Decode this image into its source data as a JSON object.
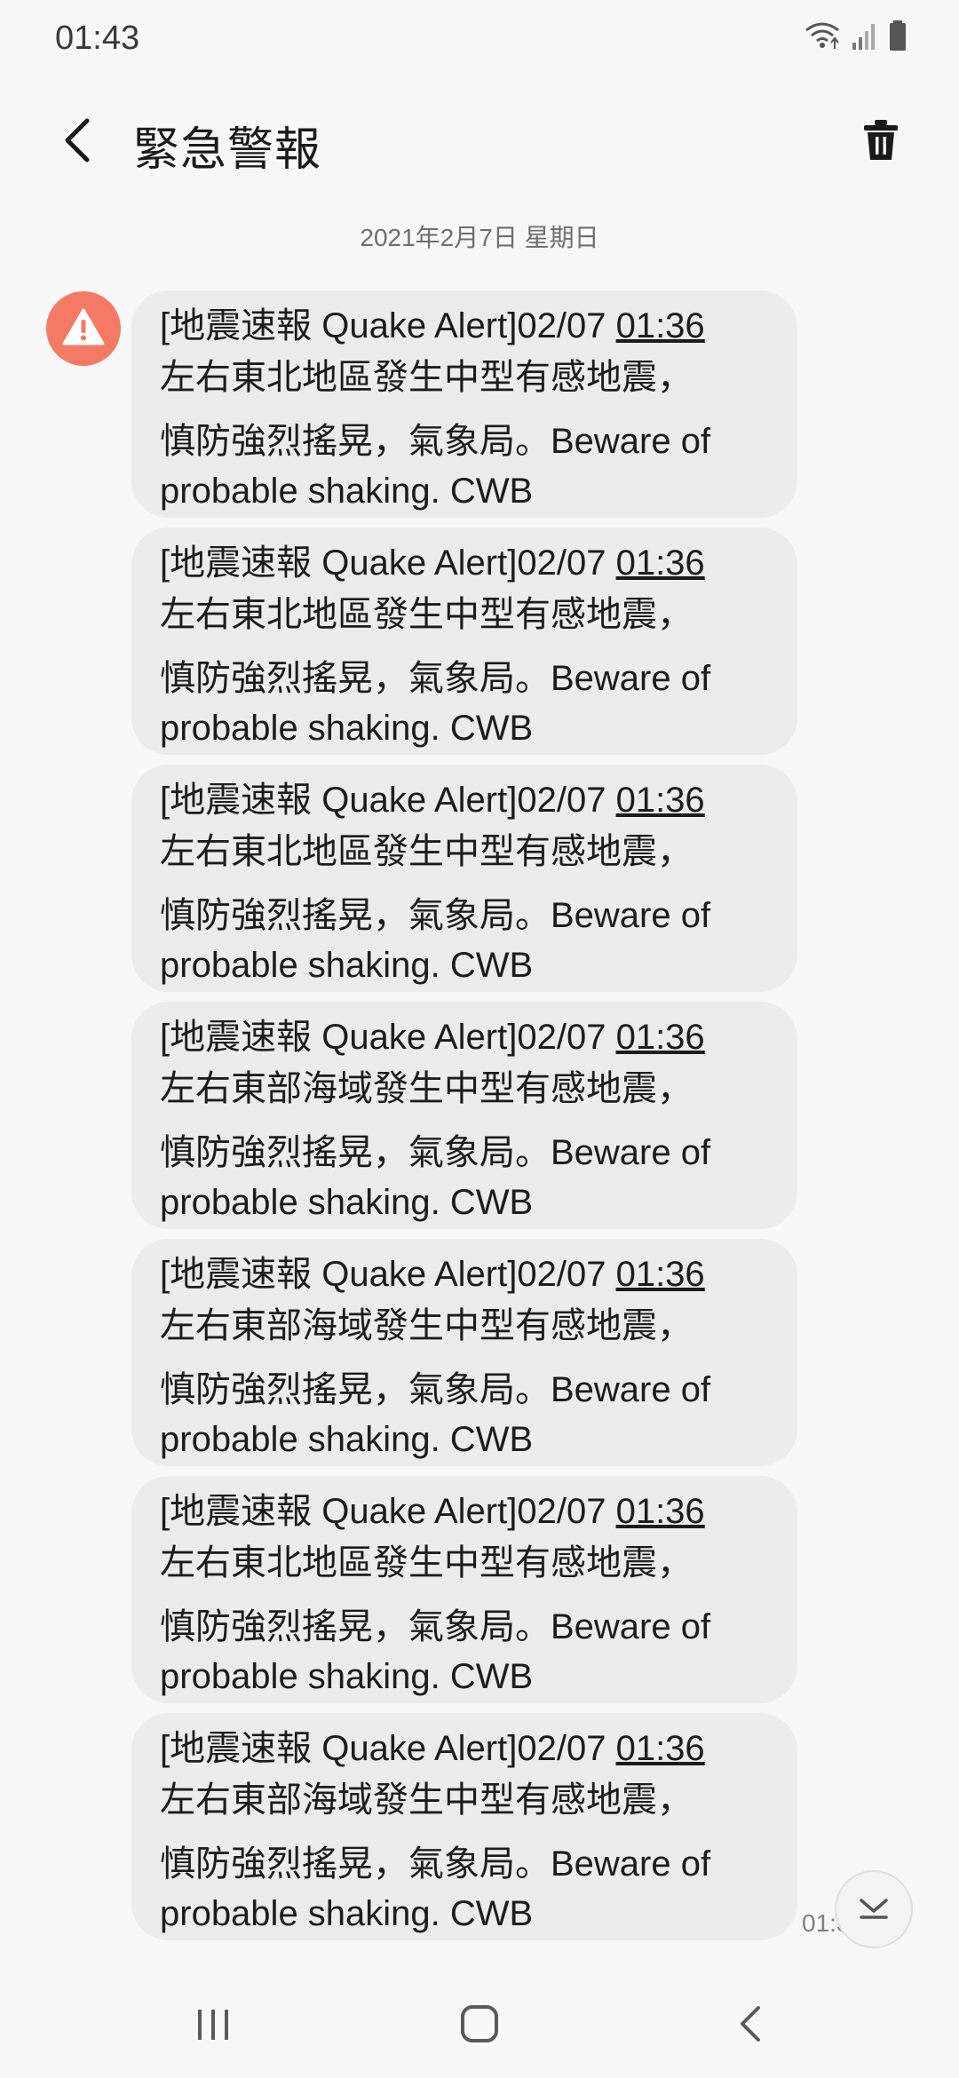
{
  "status_bar": {
    "time": "01:43"
  },
  "header": {
    "title": "緊急警報"
  },
  "date_separator": "2021年2月7日 星期日",
  "messages": [
    {
      "prefix": "[地震速報 Quake Alert]02/07 ",
      "time_link": "01:36",
      "line2": "左右東北地區發生中型有感地震，",
      "line3": "慎防強烈搖晃，氣象局。Beware of",
      "line4": "probable shaking. CWB"
    },
    {
      "prefix": "[地震速報 Quake Alert]02/07 ",
      "time_link": "01:36",
      "line2": "左右東北地區發生中型有感地震，",
      "line3": "慎防強烈搖晃，氣象局。Beware of",
      "line4": "probable shaking. CWB"
    },
    {
      "prefix": "[地震速報 Quake Alert]02/07 ",
      "time_link": "01:36",
      "line2": "左右東北地區發生中型有感地震，",
      "line3": "慎防強烈搖晃，氣象局。Beware of",
      "line4": "probable shaking. CWB"
    },
    {
      "prefix": "[地震速報 Quake Alert]02/07 ",
      "time_link": "01:36",
      "line2": "左右東部海域發生中型有感地震，",
      "line3": "慎防強烈搖晃，氣象局。Beware of",
      "line4": "probable shaking. CWB"
    },
    {
      "prefix": "[地震速報 Quake Alert]02/07 ",
      "time_link": "01:36",
      "line2": "左右東部海域發生中型有感地震，",
      "line3": "慎防強烈搖晃，氣象局。Beware of",
      "line4": "probable shaking. CWB"
    },
    {
      "prefix": "[地震速報 Quake Alert]02/07 ",
      "time_link": "01:36",
      "line2": "左右東北地區發生中型有感地震，",
      "line3": "慎防強烈搖晃，氣象局。Beware of",
      "line4": "probable shaking. CWB"
    },
    {
      "prefix": "[地震速報 Quake Alert]02/07 ",
      "time_link": "01:36",
      "line2": "左右東部海域發生中型有感地震，",
      "line3": "慎防強烈搖晃，氣象局。Beware of",
      "line4": "probable shaking. CWB"
    }
  ],
  "last_message_time": "01:3",
  "icons": {
    "back": "back-arrow-icon",
    "delete": "trash-icon",
    "sender": "warning-icon",
    "scroll": "chevron-down-icon",
    "nav_recents": "recents-icon",
    "nav_home": "home-icon",
    "nav_back": "nav-back-icon"
  },
  "colors": {
    "alert_avatar": "#f47a66",
    "bubble": "#ececec",
    "background": "#f8f8f8"
  }
}
